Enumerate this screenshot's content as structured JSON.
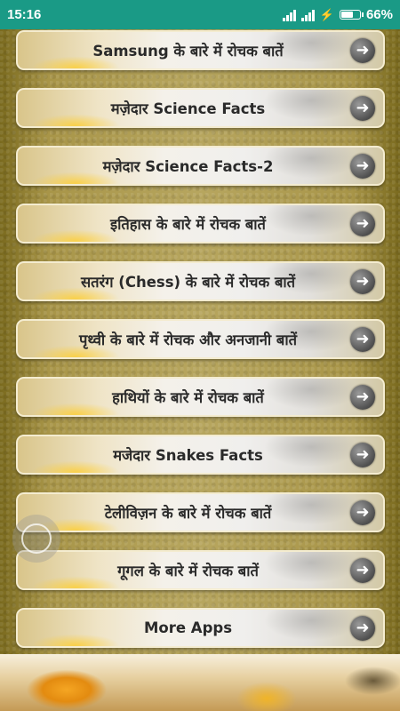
{
  "status": {
    "time": "15:16",
    "charging_icon": "⚡",
    "battery_percent": "66%",
    "battery_level": 0.66
  },
  "menu": {
    "items": [
      {
        "label": "Samsung के बारे में रोचक बातें"
      },
      {
        "label": "मज़ेदार Science Facts"
      },
      {
        "label": "मज़ेदार Science Facts-2"
      },
      {
        "label": "इतिहास के बारे में रोचक बातें"
      },
      {
        "label": "सतरंग (Chess) के बारे में रोचक बातें"
      },
      {
        "label": "पृथ्वी के बारे में रोचक और अनजानी बातें"
      },
      {
        "label": "हाथियों के बारे में रोचक बातें"
      },
      {
        "label": "मजेदार Snakes Facts"
      },
      {
        "label": "टेलीविज़न के बारे में रोचक बातें"
      },
      {
        "label": "गूगल के बारे में रोचक बातें"
      },
      {
        "label": "More Apps"
      }
    ],
    "arrow_icon": "➜"
  },
  "colors": {
    "status_bar": "#1a9a86",
    "label_text": "#2a2a2a"
  }
}
